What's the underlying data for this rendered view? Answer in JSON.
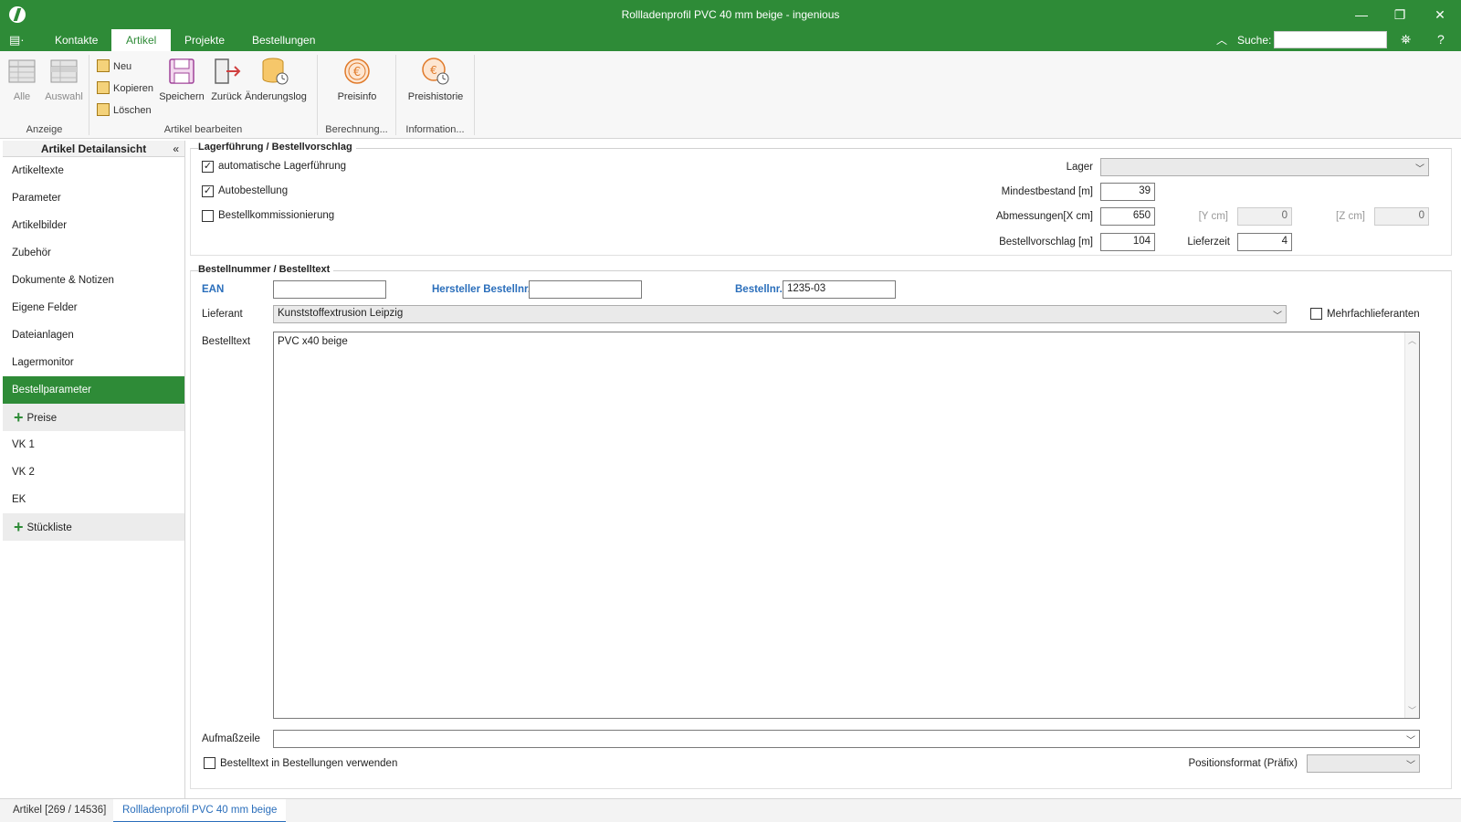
{
  "window": {
    "title": "Rollladenprofil PVC 40 mm beige - ingenious",
    "minimize_icon": "minimize-icon",
    "restore_icon": "restore-icon",
    "close_icon": "close-icon"
  },
  "menu": {
    "tabs": [
      "Kontakte",
      "Artikel",
      "Projekte",
      "Bestellungen"
    ],
    "active_tab": "Artikel",
    "search_label": "Suche:",
    "search_value": ""
  },
  "ribbon": {
    "groups": {
      "anzeige": {
        "label": "Anzeige",
        "alle": "Alle",
        "auswahl": "Auswahl"
      },
      "bearbeiten": {
        "label": "Artikel bearbeiten",
        "neu": "Neu",
        "kopieren": "Kopieren",
        "loeschen": "Löschen",
        "speichern": "Speichern",
        "zurueck": "Zurück",
        "aenderungslog": "Änderungslog"
      },
      "berechnung": {
        "label": "Berechnung...",
        "preisinfo": "Preisinfo"
      },
      "information": {
        "label": "Information...",
        "preishistorie": "Preishistorie"
      }
    }
  },
  "sidenav": {
    "title": "Artikel Detailansicht",
    "items": [
      "Artikeltexte",
      "Parameter",
      "Artikelbilder",
      "Zubehör",
      "Dokumente & Notizen",
      "Eigene Felder",
      "Dateianlagen",
      "Lagermonitor",
      "Bestellparameter"
    ],
    "active": "Bestellparameter",
    "group_preise": "Preise",
    "preise_items": [
      "VK 1",
      "VK 2",
      "EK"
    ],
    "group_stueckliste": "Stückliste"
  },
  "lager": {
    "section_title": "Lagerführung / Bestellvorschlag",
    "automatische_lagerfuehrung": {
      "label": "automatische Lagerführung",
      "checked": true
    },
    "autobestellung": {
      "label": "Autobestellung",
      "checked": true
    },
    "bestellkommissionierung": {
      "label": "Bestellkommissionierung",
      "checked": false
    },
    "lager_label": "Lager",
    "lager_value": "",
    "mindestbestand_label": "Mindestbestand [m]",
    "mindestbestand_value": "39",
    "abmessungen_label": "Abmessungen[X cm]",
    "abmessungen_x": "650",
    "y_label": "[Y cm]",
    "y_value": "0",
    "z_label": "[Z cm]",
    "z_value": "0",
    "bestellvorschlag_label": "Bestellvorschlag [m]",
    "bestellvorschlag_value": "104",
    "lieferzeit_label": "Lieferzeit",
    "lieferzeit_value": "4"
  },
  "bestellung": {
    "section_title": "Bestellnummer / Bestelltext",
    "ean_label": "EAN",
    "ean_value": "",
    "hersteller_label": "Hersteller Bestellnr.",
    "hersteller_value": "",
    "bestellnr_label": "Bestellnr.",
    "bestellnr_value": "1235-03",
    "lieferant_label": "Lieferant",
    "lieferant_value": "Kunststoffextrusion Leipzig",
    "mehrfach_label": "Mehrfachlieferanten",
    "mehrfach_checked": false,
    "bestelltext_label": "Bestelltext",
    "bestelltext_value": "PVC x40 beige",
    "aufmass_label": "Aufmaßzeile",
    "aufmass_value": "",
    "use_text_label": "Bestelltext in Bestellungen verwenden",
    "use_text_checked": false,
    "positionsformat_label": "Positionsformat (Präfix)",
    "positionsformat_value": ""
  },
  "bottom_tabs": [
    "Artikel [269 / 14536]",
    "Rollladenprofil PVC 40 mm beige"
  ],
  "colors": {
    "brand": "#2e8b37",
    "link": "#2a6ebb"
  }
}
